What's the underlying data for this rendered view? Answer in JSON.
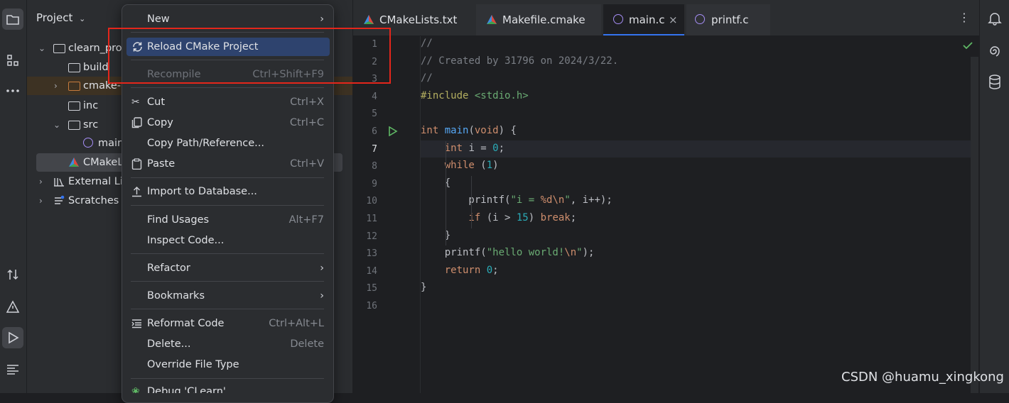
{
  "project_panel": {
    "title": "Project",
    "tree": [
      {
        "label": "clearn_pro"
      },
      {
        "label": "build"
      },
      {
        "label": "cmake-"
      },
      {
        "label": "inc"
      },
      {
        "label": "src"
      },
      {
        "label": "main"
      },
      {
        "label": "CMakeL"
      },
      {
        "label": "External Lib"
      },
      {
        "label": "Scratches"
      }
    ]
  },
  "tabs": [
    {
      "label": "CMakeLists.txt"
    },
    {
      "label": "Makefile.cmake"
    },
    {
      "label": "main.c",
      "close": "×"
    },
    {
      "label": "printf.c"
    }
  ],
  "editor": {
    "line_numbers": [
      "1",
      "2",
      "3",
      "4",
      "5",
      "6",
      "7",
      "8",
      "9",
      "10",
      "11",
      "12",
      "13",
      "14",
      "15",
      "16"
    ],
    "lines": [
      [
        {
          "t": "//",
          "c": "com"
        }
      ],
      [
        {
          "t": "// Created by 31796 on 2024/3/22.",
          "c": "com"
        }
      ],
      [
        {
          "t": "//",
          "c": "com"
        }
      ],
      [
        {
          "t": "#include ",
          "c": "pp"
        },
        {
          "t": "<stdio.h>",
          "c": "str"
        }
      ],
      [],
      [
        {
          "t": "int ",
          "c": "kw"
        },
        {
          "t": "main",
          "c": "fn"
        },
        {
          "t": "(",
          "c": "p"
        },
        {
          "t": "void",
          "c": "kw"
        },
        {
          "t": ") {",
          "c": "p"
        }
      ],
      [
        {
          "t": "    int ",
          "c": "kw"
        },
        {
          "t": "i = ",
          "c": "p"
        },
        {
          "t": "0",
          "c": "num"
        },
        {
          "t": ";",
          "c": "p"
        }
      ],
      [
        {
          "t": "    while ",
          "c": "kw"
        },
        {
          "t": "(",
          "c": "p"
        },
        {
          "t": "1",
          "c": "num"
        },
        {
          "t": ")",
          "c": "p"
        }
      ],
      [
        {
          "t": "    {",
          "c": "p"
        }
      ],
      [
        {
          "t": "        printf(",
          "c": "p"
        },
        {
          "t": "\"i = ",
          "c": "str"
        },
        {
          "t": "%d",
          "c": "kw"
        },
        {
          "t": "\\n",
          "c": "kw"
        },
        {
          "t": "\"",
          "c": "str"
        },
        {
          "t": ", i++);",
          "c": "p"
        }
      ],
      [
        {
          "t": "        if ",
          "c": "kw"
        },
        {
          "t": "(i > ",
          "c": "p"
        },
        {
          "t": "15",
          "c": "num"
        },
        {
          "t": ") ",
          "c": "p"
        },
        {
          "t": "break",
          "c": "kw"
        },
        {
          "t": ";",
          "c": "p"
        }
      ],
      [
        {
          "t": "    }",
          "c": "p"
        }
      ],
      [
        {
          "t": "    printf(",
          "c": "p"
        },
        {
          "t": "\"hello world!",
          "c": "str"
        },
        {
          "t": "\\n",
          "c": "kw"
        },
        {
          "t": "\"",
          "c": "str"
        },
        {
          "t": ");",
          "c": "p"
        }
      ],
      [
        {
          "t": "    return ",
          "c": "kw"
        },
        {
          "t": "0",
          "c": "num"
        },
        {
          "t": ";",
          "c": "p"
        }
      ],
      [
        {
          "t": "}",
          "c": "p"
        }
      ],
      []
    ]
  },
  "context_menu": {
    "items": [
      {
        "label": "New",
        "shortcut": "",
        "submenu": true
      },
      {
        "label": "Reload CMake Project",
        "shortcut": "",
        "selected": true
      },
      {
        "label": "Recompile",
        "shortcut": "Ctrl+Shift+F9",
        "disabled": true
      },
      {
        "label": "Cut",
        "shortcut": "Ctrl+X"
      },
      {
        "label": "Copy",
        "shortcut": "Ctrl+C"
      },
      {
        "label": "Copy Path/Reference...",
        "shortcut": ""
      },
      {
        "label": "Paste",
        "shortcut": "Ctrl+V"
      },
      {
        "label": "Import to Database...",
        "shortcut": ""
      },
      {
        "label": "Find Usages",
        "shortcut": "Alt+F7"
      },
      {
        "label": "Inspect Code...",
        "shortcut": ""
      },
      {
        "label": "Refactor",
        "shortcut": "",
        "submenu": true
      },
      {
        "label": "Bookmarks",
        "shortcut": "",
        "submenu": true
      },
      {
        "label": "Reformat Code",
        "shortcut": "Ctrl+Alt+L"
      },
      {
        "label": "Delete...",
        "shortcut": "Delete"
      },
      {
        "label": "Override File Type",
        "shortcut": ""
      },
      {
        "label": "Debug 'CLearn'",
        "shortcut": ""
      }
    ]
  },
  "watermark": "CSDN @huamu_xingkong",
  "colors": {
    "accent": "#3574f0",
    "highlight_box": "#e4261b",
    "selected_item": "#2e436e"
  }
}
